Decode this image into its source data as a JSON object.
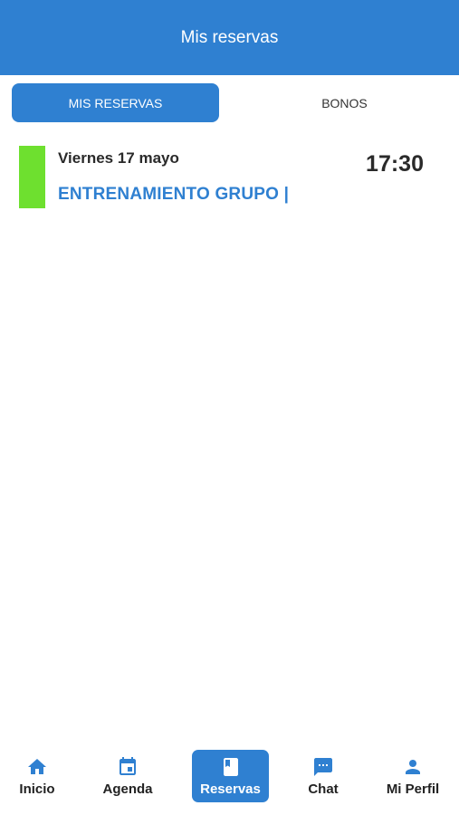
{
  "header": {
    "title": "Mis reservas"
  },
  "tabs": [
    {
      "label": "MIS RESERVAS",
      "active": true
    },
    {
      "label": "BONOS",
      "active": false
    }
  ],
  "bookings": [
    {
      "date": "Viernes 17 mayo",
      "time": "17:30",
      "activity": "ENTRENAMIENTO GRUPO |",
      "color": "#6ee02f"
    }
  ],
  "nav": [
    {
      "label": "Inicio",
      "icon": "home-icon"
    },
    {
      "label": "Agenda",
      "icon": "calendar-icon"
    },
    {
      "label": "Reservas",
      "icon": "book-icon",
      "active": true
    },
    {
      "label": "Chat",
      "icon": "chat-icon"
    },
    {
      "label": "Mi Perfil",
      "icon": "person-icon"
    }
  ],
  "colors": {
    "primary": "#2f80d1",
    "marker": "#6ee02f"
  }
}
